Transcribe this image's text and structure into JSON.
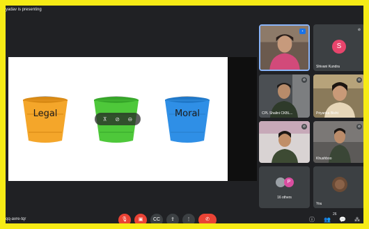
{
  "header": {
    "presenting_text": "yadav is presenting"
  },
  "slide": {
    "buckets": [
      {
        "label": "Legal",
        "color": "#f4a62a"
      },
      {
        "label": "",
        "color": "#4ec83a"
      },
      {
        "label": "Moral",
        "color": "#2f8fe6"
      }
    ]
  },
  "participants": [
    {
      "name": "",
      "initial": "",
      "active": true
    },
    {
      "name": "Shivani Kundra",
      "initial": "S",
      "avatar_color": "#e8456c"
    },
    {
      "name": "CPL Shalini CKBL...",
      "initial": ""
    },
    {
      "name": "Priyanka Bisht",
      "initial": ""
    },
    {
      "name": "",
      "initial": ""
    },
    {
      "name": "Khushboo",
      "initial": ""
    },
    {
      "name": "16 others",
      "initial": "P",
      "avatar_color": "#d94ea0"
    },
    {
      "name": "You",
      "initial": ""
    }
  ],
  "meeting": {
    "code": "qq-avre-tqr"
  },
  "controls": {
    "mic_icon": "mic-off-icon",
    "camera_icon": "camera-off-icon",
    "captions_icon": "captions-icon",
    "present_icon": "present-icon",
    "more_icon": "more-vert-icon",
    "end_icon": "end-call-icon"
  },
  "sidebar_controls": {
    "people_count": "26"
  },
  "colors": {
    "frame_border": "#f6eb16",
    "background": "#202124",
    "tile": "#3c4043",
    "end_call": "#ea4335",
    "active_speaker": "#8ab4f8"
  }
}
